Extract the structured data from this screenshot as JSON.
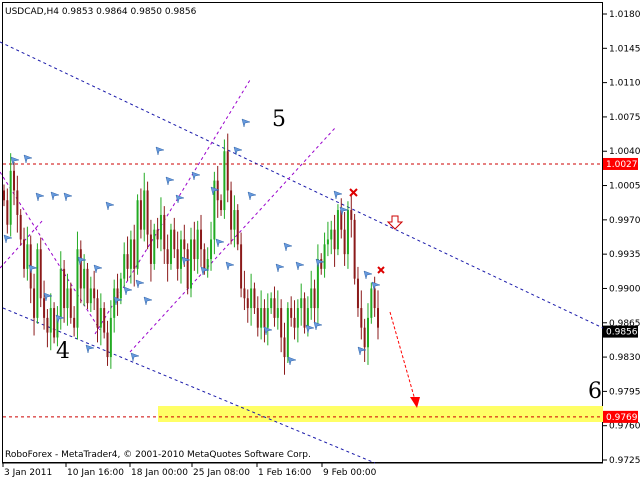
{
  "title": "USDCAD,H4  0.9853 0.9864 0.9850 0.9856",
  "footer": "RoboForex - MetaTrader4, © 2001-2010 MetaQuotes Software Corp.",
  "colors": {
    "bull": "#22aa22",
    "bear": "#8b1a1a",
    "red_line": "#cc0000",
    "blue_dash": "#1a1aaa",
    "purple_dash": "#9900cc",
    "zone": "#ffff66",
    "current_box": "#000000",
    "level_box": "#ff0000",
    "marker": "#6699dd"
  },
  "chart_data": {
    "type": "candlestick",
    "symbol": "USDCAD",
    "timeframe": "H4",
    "ohlc_header": {
      "open": 0.9853,
      "high": 0.9864,
      "low": 0.985,
      "close": 0.9856
    },
    "ylim": [
      0.9725,
      1.018
    ],
    "y_ticks": [
      "1.0180",
      "1.0145",
      "1.0110",
      "1.0075",
      "1.0040",
      "1.0005",
      "0.9970",
      "0.9935",
      "0.9900",
      "0.9865",
      "0.9830",
      "0.9795",
      "0.9760",
      "0.9725"
    ],
    "x_ticks": [
      "3 Jan 2011",
      "10 Jan 16:00",
      "18 Jan 00:00",
      "25 Jan 08:00",
      "1 Feb 16:00",
      "9 Feb 00:00"
    ],
    "levels": [
      {
        "value": 1.0027,
        "label": "1.0027"
      },
      {
        "value": 0.9769,
        "label": "0.9769"
      }
    ],
    "current_price": {
      "value": 0.9856,
      "label": "0.9856"
    },
    "wave_labels": [
      "5",
      "4",
      "6"
    ],
    "closes": [
      0.999,
      0.9965,
      1.002,
      1.0,
      0.9975,
      0.995,
      0.992,
      0.9945,
      0.99,
      0.987,
      0.994,
      0.989,
      0.987,
      0.9855,
      0.988,
      0.985,
      0.987,
      0.992,
      0.988,
      0.99,
      0.987,
      0.986,
      0.994,
      0.99,
      0.992,
      0.9885,
      0.99,
      0.989,
      0.986,
      0.988,
      0.9855,
      0.983,
      0.987,
      0.99,
      0.989,
      0.991,
      0.9935,
      0.992,
      0.995,
      0.992,
      0.999,
      0.996,
      1.0,
      0.9955,
      0.9925,
      0.996,
      0.995,
      0.9975,
      0.994,
      0.9925,
      0.996,
      0.994,
      0.992,
      0.995,
      0.994,
      0.99,
      0.995,
      0.993,
      0.996,
      0.994,
      0.992,
      0.993,
      0.995,
      1.001,
      0.999,
      0.998,
      1.004,
      1.0,
      0.996,
      0.998,
      0.9945,
      0.99,
      0.989,
      0.988,
      0.99,
      0.988,
      0.986,
      0.988,
      0.986,
      0.988,
      0.989,
      0.987,
      0.988,
      0.985,
      0.983,
      0.988,
      0.987,
      0.986,
      0.988,
      0.989,
      0.986,
      0.988,
      0.99,
      0.988,
      0.993,
      0.992,
      0.9945,
      0.995,
      0.996,
      0.994,
      0.998,
      0.996,
      0.9935,
      0.998,
      0.997,
      0.991,
      0.988,
      0.986,
      0.984,
      0.987,
      0.99,
      0.988,
      0.986
    ]
  }
}
